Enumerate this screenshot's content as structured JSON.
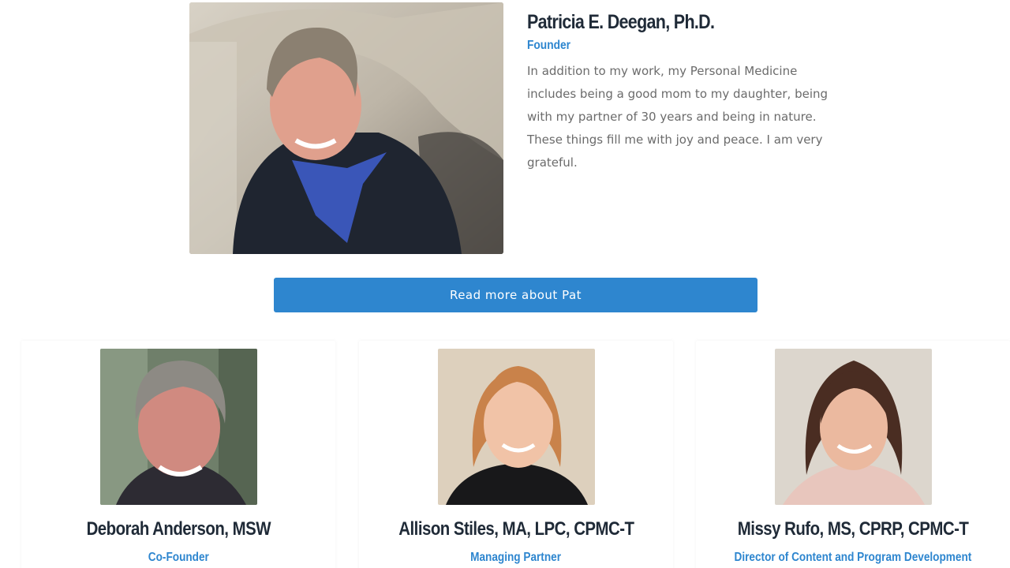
{
  "founder": {
    "name": "Patricia E. Deegan, Ph.D.",
    "role": "Founder",
    "bio": "In addition to my work, my Personal Medicine includes being a good mom to my daughter, being with my partner of 30 years and being in nature. These things fill me with joy and peace. I am very grateful.",
    "read_more_label": "Read more about Pat"
  },
  "team": [
    {
      "name": "Deborah Anderson, MSW",
      "role": "Co-Founder"
    },
    {
      "name": "Allison Stiles, MA, LPC, CPMC-T",
      "role": "Managing Partner"
    },
    {
      "name": "Missy Rufo, MS, CPRP, CPMC-T",
      "role": "Director of Content and Program Development"
    }
  ],
  "colors": {
    "accent": "#2e86cf",
    "heading": "#1f2a37",
    "body_text": "#6b6b6b"
  }
}
